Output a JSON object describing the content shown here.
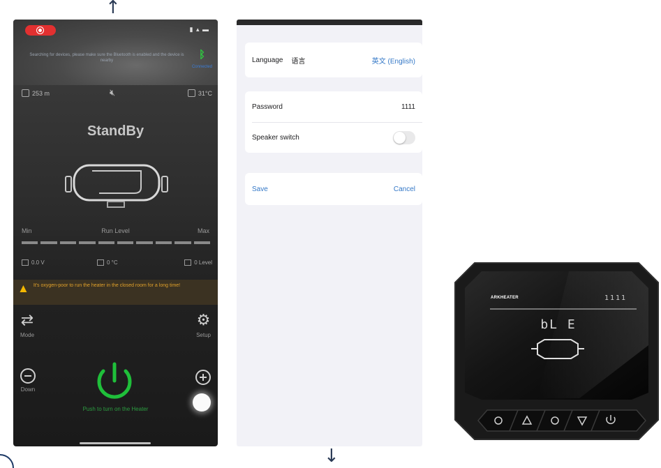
{
  "phone_app": {
    "status_bar": {
      "indicators": "▮ ▴ ▬"
    },
    "connection": {
      "message": "Searching for devices, please make sure the Bluetooth is enabled and the device is nearby",
      "bluetooth_label": "Connected"
    },
    "stats": {
      "altitude": "253 m",
      "temperature": "31°C"
    },
    "status_title": "StandBy",
    "run_level": {
      "min_label": "Min",
      "label": "Run Level",
      "max_label": "Max",
      "segments": 10,
      "filled": 0
    },
    "meters": {
      "voltage": "0.0 V",
      "gas": "0 °C",
      "level": "0 Level"
    },
    "warning": "It's oxygen-poor to run the heater in the closed room for a long time!",
    "controls": {
      "mode_label": "Mode",
      "setup_label": "Setup",
      "down_label": "Down",
      "power_label": "Push to turn on the Heater"
    },
    "icons": [
      "camera-icon",
      "mute-icon",
      "thermometer-icon",
      "bluetooth-icon",
      "battery-icon",
      "fuel-icon",
      "level-icon",
      "warning-icon",
      "mode-icon",
      "gear-icon",
      "minus-icon",
      "plus-icon",
      "power-icon"
    ],
    "colors": {
      "accent_green": "#2ecc40",
      "warning": "#f5b800",
      "bluetooth_blue": "#3a7dd8"
    }
  },
  "settings": {
    "language": {
      "label": "Language",
      "label_cn": "语言",
      "value": "英文 (English)"
    },
    "password": {
      "label": "Password",
      "value": "1111"
    },
    "speaker": {
      "label": "Speaker switch",
      "enabled": false
    },
    "save_label": "Save",
    "cancel_label": "Cancel",
    "colors": {
      "link": "#3478c7"
    }
  },
  "device": {
    "brand": "ARKHEATER",
    "indicator": "1111",
    "display": "bL E",
    "buttons": [
      "gear-icon",
      "up-triangle-icon",
      "circle-icon",
      "down-triangle-icon",
      "power-icon"
    ]
  }
}
